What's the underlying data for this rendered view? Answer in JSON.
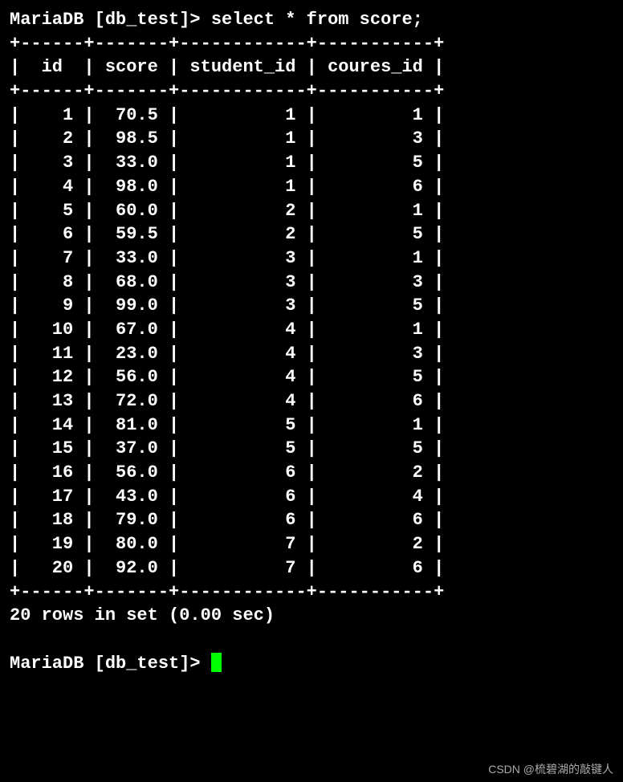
{
  "prompt1": "MariaDB [db_test]> ",
  "query": "select * from score;",
  "columns": [
    "id",
    "score",
    "student_id",
    "coures_id"
  ],
  "widths": [
    6,
    7,
    12,
    11
  ],
  "rows": [
    {
      "id": 1,
      "score": "70.5",
      "student_id": 1,
      "coures_id": 1
    },
    {
      "id": 2,
      "score": "98.5",
      "student_id": 1,
      "coures_id": 3
    },
    {
      "id": 3,
      "score": "33.0",
      "student_id": 1,
      "coures_id": 5
    },
    {
      "id": 4,
      "score": "98.0",
      "student_id": 1,
      "coures_id": 6
    },
    {
      "id": 5,
      "score": "60.0",
      "student_id": 2,
      "coures_id": 1
    },
    {
      "id": 6,
      "score": "59.5",
      "student_id": 2,
      "coures_id": 5
    },
    {
      "id": 7,
      "score": "33.0",
      "student_id": 3,
      "coures_id": 1
    },
    {
      "id": 8,
      "score": "68.0",
      "student_id": 3,
      "coures_id": 3
    },
    {
      "id": 9,
      "score": "99.0",
      "student_id": 3,
      "coures_id": 5
    },
    {
      "id": 10,
      "score": "67.0",
      "student_id": 4,
      "coures_id": 1
    },
    {
      "id": 11,
      "score": "23.0",
      "student_id": 4,
      "coures_id": 3
    },
    {
      "id": 12,
      "score": "56.0",
      "student_id": 4,
      "coures_id": 5
    },
    {
      "id": 13,
      "score": "72.0",
      "student_id": 4,
      "coures_id": 6
    },
    {
      "id": 14,
      "score": "81.0",
      "student_id": 5,
      "coures_id": 1
    },
    {
      "id": 15,
      "score": "37.0",
      "student_id": 5,
      "coures_id": 5
    },
    {
      "id": 16,
      "score": "56.0",
      "student_id": 6,
      "coures_id": 2
    },
    {
      "id": 17,
      "score": "43.0",
      "student_id": 6,
      "coures_id": 4
    },
    {
      "id": 18,
      "score": "79.0",
      "student_id": 6,
      "coures_id": 6
    },
    {
      "id": 19,
      "score": "80.0",
      "student_id": 7,
      "coures_id": 2
    },
    {
      "id": 20,
      "score": "92.0",
      "student_id": 7,
      "coures_id": 6
    }
  ],
  "result_msg": "20 rows in set (0.00 sec)",
  "prompt2": "MariaDB [db_test]> ",
  "watermark": "CSDN @梳碧湖的敲键人"
}
